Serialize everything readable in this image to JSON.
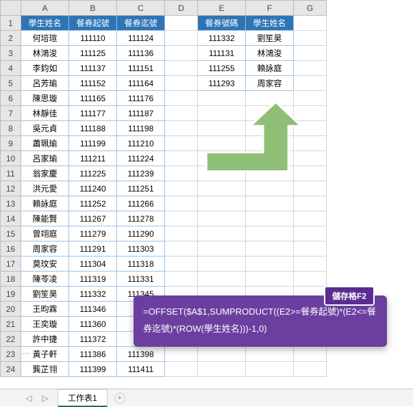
{
  "columns": [
    "A",
    "B",
    "C",
    "D",
    "E",
    "F",
    "G"
  ],
  "rowcount": 24,
  "left": {
    "headers": [
      "學生姓名",
      "餐券起號",
      "餐券迄號"
    ],
    "rows": [
      [
        "何培瑄",
        "111110",
        "111124"
      ],
      [
        "林鴻浚",
        "111125",
        "111136"
      ],
      [
        "李鈞如",
        "111137",
        "111151"
      ],
      [
        "呂芳瑜",
        "111152",
        "111164"
      ],
      [
        "陳思璇",
        "111165",
        "111176"
      ],
      [
        "林靜佳",
        "111177",
        "111187"
      ],
      [
        "吳元貞",
        "111188",
        "111198"
      ],
      [
        "蕭珮瑜",
        "111199",
        "111210"
      ],
      [
        "呂家瑜",
        "111211",
        "111224"
      ],
      [
        "翁家慶",
        "111225",
        "111239"
      ],
      [
        "洪元愛",
        "111240",
        "111251"
      ],
      [
        "賴詠庭",
        "111252",
        "111266"
      ],
      [
        "陳能賢",
        "111267",
        "111278"
      ],
      [
        "曾翊庭",
        "111279",
        "111290"
      ],
      [
        "周家容",
        "111291",
        "111303"
      ],
      [
        "莫玟安",
        "111304",
        "111318"
      ],
      [
        "陳苓凌",
        "111319",
        "111331"
      ],
      [
        "劉笙昊",
        "111332",
        "111345"
      ],
      [
        "王昀霖",
        "111346",
        ""
      ],
      [
        "王奕璇",
        "111360",
        ""
      ],
      [
        "許中捷",
        "111372",
        ""
      ],
      [
        "黃子軒",
        "111386",
        "111398"
      ],
      [
        "龔芷翎",
        "111399",
        "111411"
      ]
    ]
  },
  "right": {
    "headers": [
      "餐券號碼",
      "學生姓名"
    ],
    "rows": [
      [
        "111332",
        "劉笙昊"
      ],
      [
        "111131",
        "林鴻浚"
      ],
      [
        "111255",
        "賴詠庭"
      ],
      [
        "111293",
        "周家容"
      ]
    ]
  },
  "callout": {
    "badge": "儲存格F2",
    "formula": "=OFFSET($A$1,SUMPRODUCT((E2>=餐券起號)*(E2<=餐券迄號)*(ROW(學生姓名)))-1,0)"
  },
  "tab": {
    "nav_left": "◁",
    "nav_right": "▷",
    "name": "工作表1",
    "add": "+"
  },
  "ellipsis": "⋯",
  "chart_data": {
    "type": "table",
    "title": "",
    "tables": [
      {
        "name": "left",
        "columns": [
          "學生姓名",
          "餐券起號",
          "餐券迄號"
        ],
        "rows": [
          [
            "何培瑄",
            111110,
            111124
          ],
          [
            "林鴻浚",
            111125,
            111136
          ],
          [
            "李鈞如",
            111137,
            111151
          ],
          [
            "呂芳瑜",
            111152,
            111164
          ],
          [
            "陳思璇",
            111165,
            111176
          ],
          [
            "林靜佳",
            111177,
            111187
          ],
          [
            "吳元貞",
            111188,
            111198
          ],
          [
            "蕭珮瑜",
            111199,
            111210
          ],
          [
            "呂家瑜",
            111211,
            111224
          ],
          [
            "翁家慶",
            111225,
            111239
          ],
          [
            "洪元愛",
            111240,
            111251
          ],
          [
            "賴詠庭",
            111252,
            111266
          ],
          [
            "陳能賢",
            111267,
            111278
          ],
          [
            "曾翊庭",
            111279,
            111290
          ],
          [
            "周家容",
            111291,
            111303
          ],
          [
            "莫玟安",
            111304,
            111318
          ],
          [
            "陳苓凌",
            111319,
            111331
          ],
          [
            "劉笙昊",
            111332,
            111345
          ],
          [
            "王昀霖",
            111346,
            null
          ],
          [
            "王奕璇",
            111360,
            null
          ],
          [
            "許中捷",
            111372,
            null
          ],
          [
            "黃子軒",
            111386,
            111398
          ],
          [
            "龔芷翎",
            111399,
            111411
          ]
        ]
      },
      {
        "name": "right",
        "columns": [
          "餐券號碼",
          "學生姓名"
        ],
        "rows": [
          [
            111332,
            "劉笙昊"
          ],
          [
            111131,
            "林鴻浚"
          ],
          [
            111255,
            "賴詠庭"
          ],
          [
            111293,
            "周家容"
          ]
        ]
      }
    ]
  }
}
